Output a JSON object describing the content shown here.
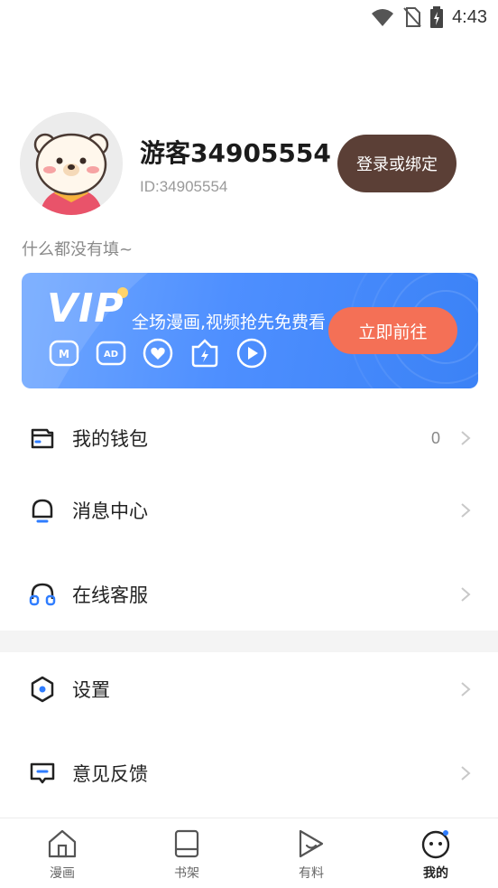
{
  "status_bar": {
    "time": "4:43",
    "icons": [
      "wifi-icon",
      "no-sim-icon",
      "battery-charging-icon"
    ]
  },
  "profile": {
    "username": "游客34905554",
    "user_id": "ID:34905554",
    "login_button": "登录或绑定",
    "bio": "什么都没有填~",
    "avatar": "bear-avatar"
  },
  "vip": {
    "title": "VIP",
    "slogan": "全场漫画,视频抢先免费看",
    "button": "立即前往",
    "benefit_icons": [
      "manga-icon",
      "ad-free-icon",
      "heart-icon",
      "badge-icon",
      "play-icon"
    ]
  },
  "menu": [
    {
      "label": "我的钱包",
      "value": "0",
      "icon": "wallet-icon"
    },
    {
      "label": "消息中心",
      "value": "",
      "icon": "bell-icon"
    },
    {
      "label": "在线客服",
      "value": "",
      "icon": "headset-icon"
    },
    {
      "label": "设置",
      "value": "",
      "icon": "settings-hexagon-icon"
    },
    {
      "label": "意见反馈",
      "value": "",
      "icon": "feedback-icon"
    }
  ],
  "bottom_nav": [
    {
      "label": "漫画",
      "icon": "home-icon",
      "active": false
    },
    {
      "label": "书架",
      "icon": "bookshelf-icon",
      "active": false
    },
    {
      "label": "有料",
      "icon": "play-bubble-icon",
      "active": false
    },
    {
      "label": "我的",
      "icon": "face-icon",
      "active": true
    }
  ],
  "colors": {
    "login_button": "#5b3f36",
    "vip_gradient_start": "#6fa7ff",
    "vip_gradient_end": "#3b82f6",
    "vip_cta": "#f47056",
    "accent_blue": "#2f7dff"
  }
}
